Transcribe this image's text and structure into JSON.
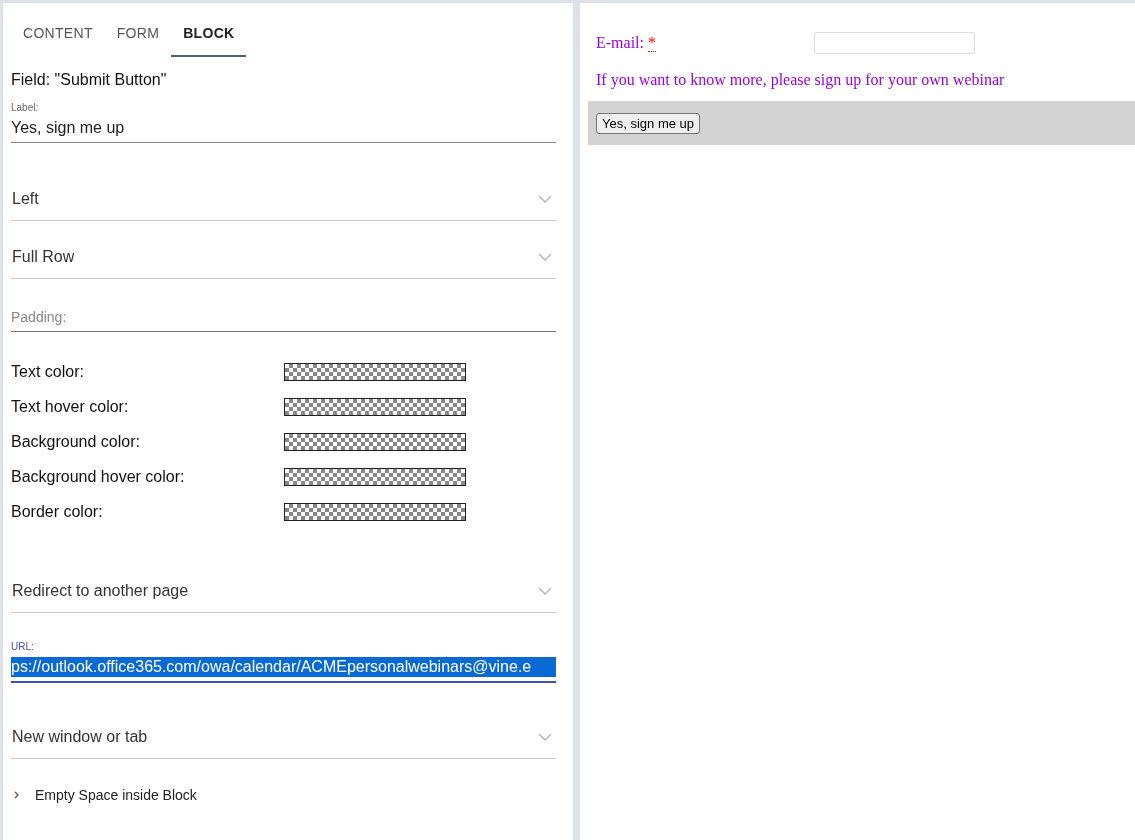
{
  "tabs": [
    {
      "label": "CONTENT",
      "selected": false
    },
    {
      "label": "FORM",
      "selected": false
    },
    {
      "label": "BLOCK",
      "selected": true
    }
  ],
  "field_title": "Field: \"Submit Button\"",
  "controls": [
    {
      "kind": "text",
      "label": "Label:",
      "value": "Yes, sign me up",
      "focused": false
    },
    {
      "kind": "select",
      "value": "Left"
    },
    {
      "kind": "select",
      "value": "Full Row"
    },
    {
      "kind": "text",
      "placeholder": "Padding:",
      "focused": false
    },
    {
      "kind": "color",
      "label": "Text color:"
    },
    {
      "kind": "color",
      "label": "Text hover color:"
    },
    {
      "kind": "color",
      "label": "Background color:"
    },
    {
      "kind": "color",
      "label": "Background hover color:"
    },
    {
      "kind": "color",
      "label": "Border color:"
    },
    {
      "kind": "select",
      "value": "Redirect to another page"
    },
    {
      "kind": "text",
      "label": "URL:",
      "value": "ps://outlook.office365.com/owa/calendar/ACMEpersonalwebinars@vine.e",
      "focused": true,
      "text_selected": true
    },
    {
      "kind": "select",
      "value": "New window or tab"
    },
    {
      "kind": "expander",
      "label": "Empty Space inside Block",
      "expanded": false
    }
  ],
  "preview": {
    "email_label": "E-mail:",
    "required_mark": "*",
    "intro": "If you want to know more, please sign up for your own webinar",
    "button": "Yes, sign me up"
  }
}
